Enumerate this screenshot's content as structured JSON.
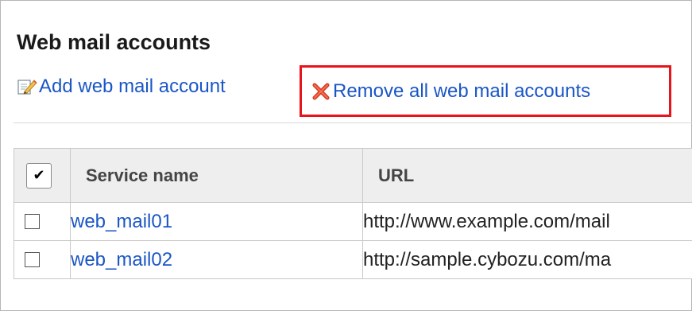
{
  "page": {
    "title": "Web mail accounts"
  },
  "actions": {
    "add_label": "Add web mail account",
    "remove_all_label": "Remove all web mail accounts"
  },
  "table": {
    "headers": {
      "service_name": "Service name",
      "url": "URL"
    },
    "rows": [
      {
        "service_name": "web_mail01",
        "url": "http://www.example.com/mail",
        "checked": false
      },
      {
        "service_name": "web_mail02",
        "url": "http://sample.cybozu.com/ma",
        "checked": false
      }
    ],
    "select_all_checked": true
  },
  "colors": {
    "link": "#1a56c6",
    "highlight_border": "#e8141b",
    "header_bg": "#eeeeee"
  },
  "icons": {
    "add": "edit-pencil-icon",
    "remove": "red-x-icon",
    "select_all": "checkmark-icon"
  }
}
